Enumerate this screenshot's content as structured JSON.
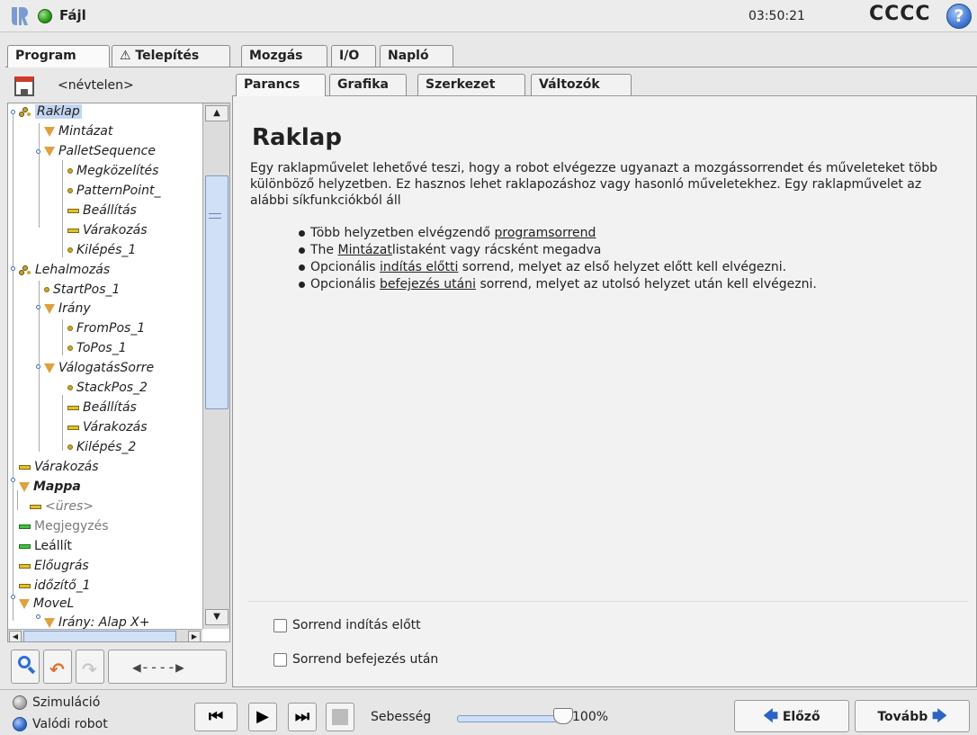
{
  "header": {
    "file_label": "Fájl",
    "clock": "03:50:21",
    "robot_name": "CCCC",
    "help_label": "?"
  },
  "main_tabs": [
    {
      "label": "Program",
      "active": true
    },
    {
      "label": "⚠ Telepítés",
      "active": false
    },
    {
      "label": "Mozgás",
      "active": false
    },
    {
      "label": "I/O",
      "active": false
    },
    {
      "label": "Napló",
      "active": false
    }
  ],
  "program_name": "<névtelen>",
  "tree": [
    {
      "label": "Raklap",
      "icon": "pallet-icon"
    },
    {
      "label": "Mintázat",
      "icon": "triangle-icon"
    },
    {
      "label": "PalletSequence",
      "icon": "triangle-icon"
    },
    {
      "label": "Megközelítés",
      "icon": "waypoint-icon"
    },
    {
      "label": "PatternPoint_",
      "icon": "waypoint-icon"
    },
    {
      "label": "Beállítás",
      "icon": "set-icon"
    },
    {
      "label": "Várakozás",
      "icon": "wait-icon"
    },
    {
      "label": "Kilépés_1",
      "icon": "waypoint-icon"
    },
    {
      "label": "Lehalmozás",
      "icon": "pallet-icon"
    },
    {
      "label": "StartPos_1",
      "icon": "waypoint-icon"
    },
    {
      "label": "Irány",
      "icon": "triangle-icon"
    },
    {
      "label": "FromPos_1",
      "icon": "waypoint-icon"
    },
    {
      "label": "ToPos_1",
      "icon": "waypoint-icon"
    },
    {
      "label": "VálogatásSorre",
      "icon": "triangle-icon"
    },
    {
      "label": "StackPos_2",
      "icon": "waypoint-icon"
    },
    {
      "label": "Beállítás",
      "icon": "set-icon"
    },
    {
      "label": "Várakozás",
      "icon": "wait-icon"
    },
    {
      "label": "Kilépés_2",
      "icon": "waypoint-icon"
    },
    {
      "label": "Várakozás",
      "icon": "wait-icon"
    },
    {
      "label": "Mappa",
      "icon": "triangle-icon"
    },
    {
      "label": "<üres>",
      "icon": "empty-icon"
    },
    {
      "label": "Megjegyzés",
      "icon": "comment-icon"
    },
    {
      "label": "Leállít",
      "icon": "halt-icon"
    },
    {
      "label": "Előugrás",
      "icon": "popup-icon"
    },
    {
      "label": "időzítő_1",
      "icon": "timer-icon"
    },
    {
      "label": "MoveL",
      "icon": "triangle-icon"
    },
    {
      "label": "Irány: Alap X+",
      "icon": "triangle-icon"
    }
  ],
  "sub_tabs": [
    {
      "label": "Parancs",
      "active": true
    },
    {
      "label": "Grafika",
      "active": false
    },
    {
      "label": "Szerkezet",
      "active": false
    },
    {
      "label": "Változók",
      "active": false
    }
  ],
  "content": {
    "title": "Raklap",
    "description": "Egy raklapművelet lehetővé teszi, hogy a robot elvégezze ugyanazt a mozgássorrendet és műveleteket több különböző helyzetben. Ez hasznos lehet raklapozáshoz vagy hasonló műveletekhez. Egy raklapművelet az alábbi síkfunkciókból áll",
    "bullets": [
      {
        "pre": "Több helyzetben elvégzendő ",
        "link": "programsorrend",
        "post": ""
      },
      {
        "pre": "The ",
        "link": "Mintázat",
        "post": "listaként vagy rácsként megadva"
      },
      {
        "pre": "Opcionális ",
        "link": "indítás előtti",
        "post": " sorrend, melyet az első helyzet előtt kell elvégezni."
      },
      {
        "pre": "Opcionális ",
        "link": "befejezés utáni",
        "post": " sorrend, melyet az utolsó helyzet után kell elvégezni."
      }
    ],
    "options": [
      {
        "label": "Sorrend indítás előtt",
        "checked": false
      },
      {
        "label": "Sorrend befejezés után",
        "checked": false
      }
    ]
  },
  "bottom": {
    "mode_simulation": "Szimuláció",
    "mode_real": "Valódi robot",
    "speed_label": "Sebesség",
    "speed_value": "100%",
    "speed_fraction": 1.0,
    "prev_label": "Előző",
    "next_label": "Tovább"
  },
  "colors": {
    "selection": "#c3d6f2",
    "accent_blue": "#2c64c4",
    "status_green": "#2e9a1c"
  }
}
